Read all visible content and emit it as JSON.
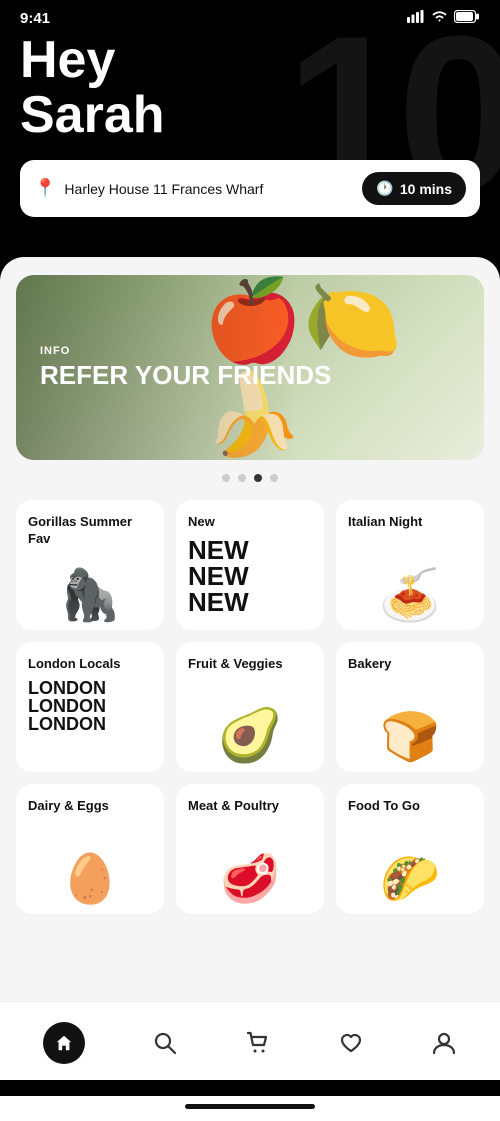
{
  "statusBar": {
    "time": "9:41",
    "signal": "▋▋▋▋",
    "wifi": "wifi",
    "battery": "🔋"
  },
  "header": {
    "bgNumber": "10",
    "greeting_line1": "Hey",
    "greeting_line2": "Sarah",
    "location": "Harley House 11 Frances Wharf",
    "deliveryTime": "10 mins"
  },
  "banner": {
    "info_label": "INFO",
    "title": "REFER YOUR FRIENDS",
    "dot_count": 4,
    "active_dot": 2
  },
  "categories": [
    {
      "id": "gorillas-summer-fav",
      "title": "Gorillas Summer Fav",
      "subtitle": "",
      "emoji": "🦍"
    },
    {
      "id": "new",
      "title": "New",
      "subtitle": "NEW\nNEW\nNEW",
      "emoji": ""
    },
    {
      "id": "italian-night",
      "title": "Italian Night",
      "subtitle": "",
      "emoji": "🍝"
    },
    {
      "id": "london-locals",
      "title": "London Locals",
      "subtitle": "LONDON\nLONDON\nLONDON",
      "emoji": ""
    },
    {
      "id": "fruit-veggies",
      "title": "Fruit & Veggies",
      "subtitle": "",
      "emoji": "🥑"
    },
    {
      "id": "bakery",
      "title": "Bakery",
      "subtitle": "",
      "emoji": "🍞"
    },
    {
      "id": "dairy-eggs",
      "title": "Dairy & Eggs",
      "subtitle": "",
      "emoji": "🥚"
    },
    {
      "id": "meat-poultry",
      "title": "Meat & Poultry",
      "subtitle": "",
      "emoji": "🥩"
    },
    {
      "id": "food-to-go",
      "title": "Food To Go",
      "subtitle": "",
      "emoji": "🌮"
    }
  ],
  "bottomNav": [
    {
      "id": "home",
      "icon": "🏠",
      "label": "Home",
      "active": true
    },
    {
      "id": "search",
      "icon": "🔍",
      "label": "Search",
      "active": false
    },
    {
      "id": "cart",
      "icon": "🛒",
      "label": "Cart",
      "active": false
    },
    {
      "id": "favorites",
      "icon": "♡",
      "label": "Favorites",
      "active": false
    },
    {
      "id": "profile",
      "icon": "👤",
      "label": "Profile",
      "active": false
    }
  ]
}
